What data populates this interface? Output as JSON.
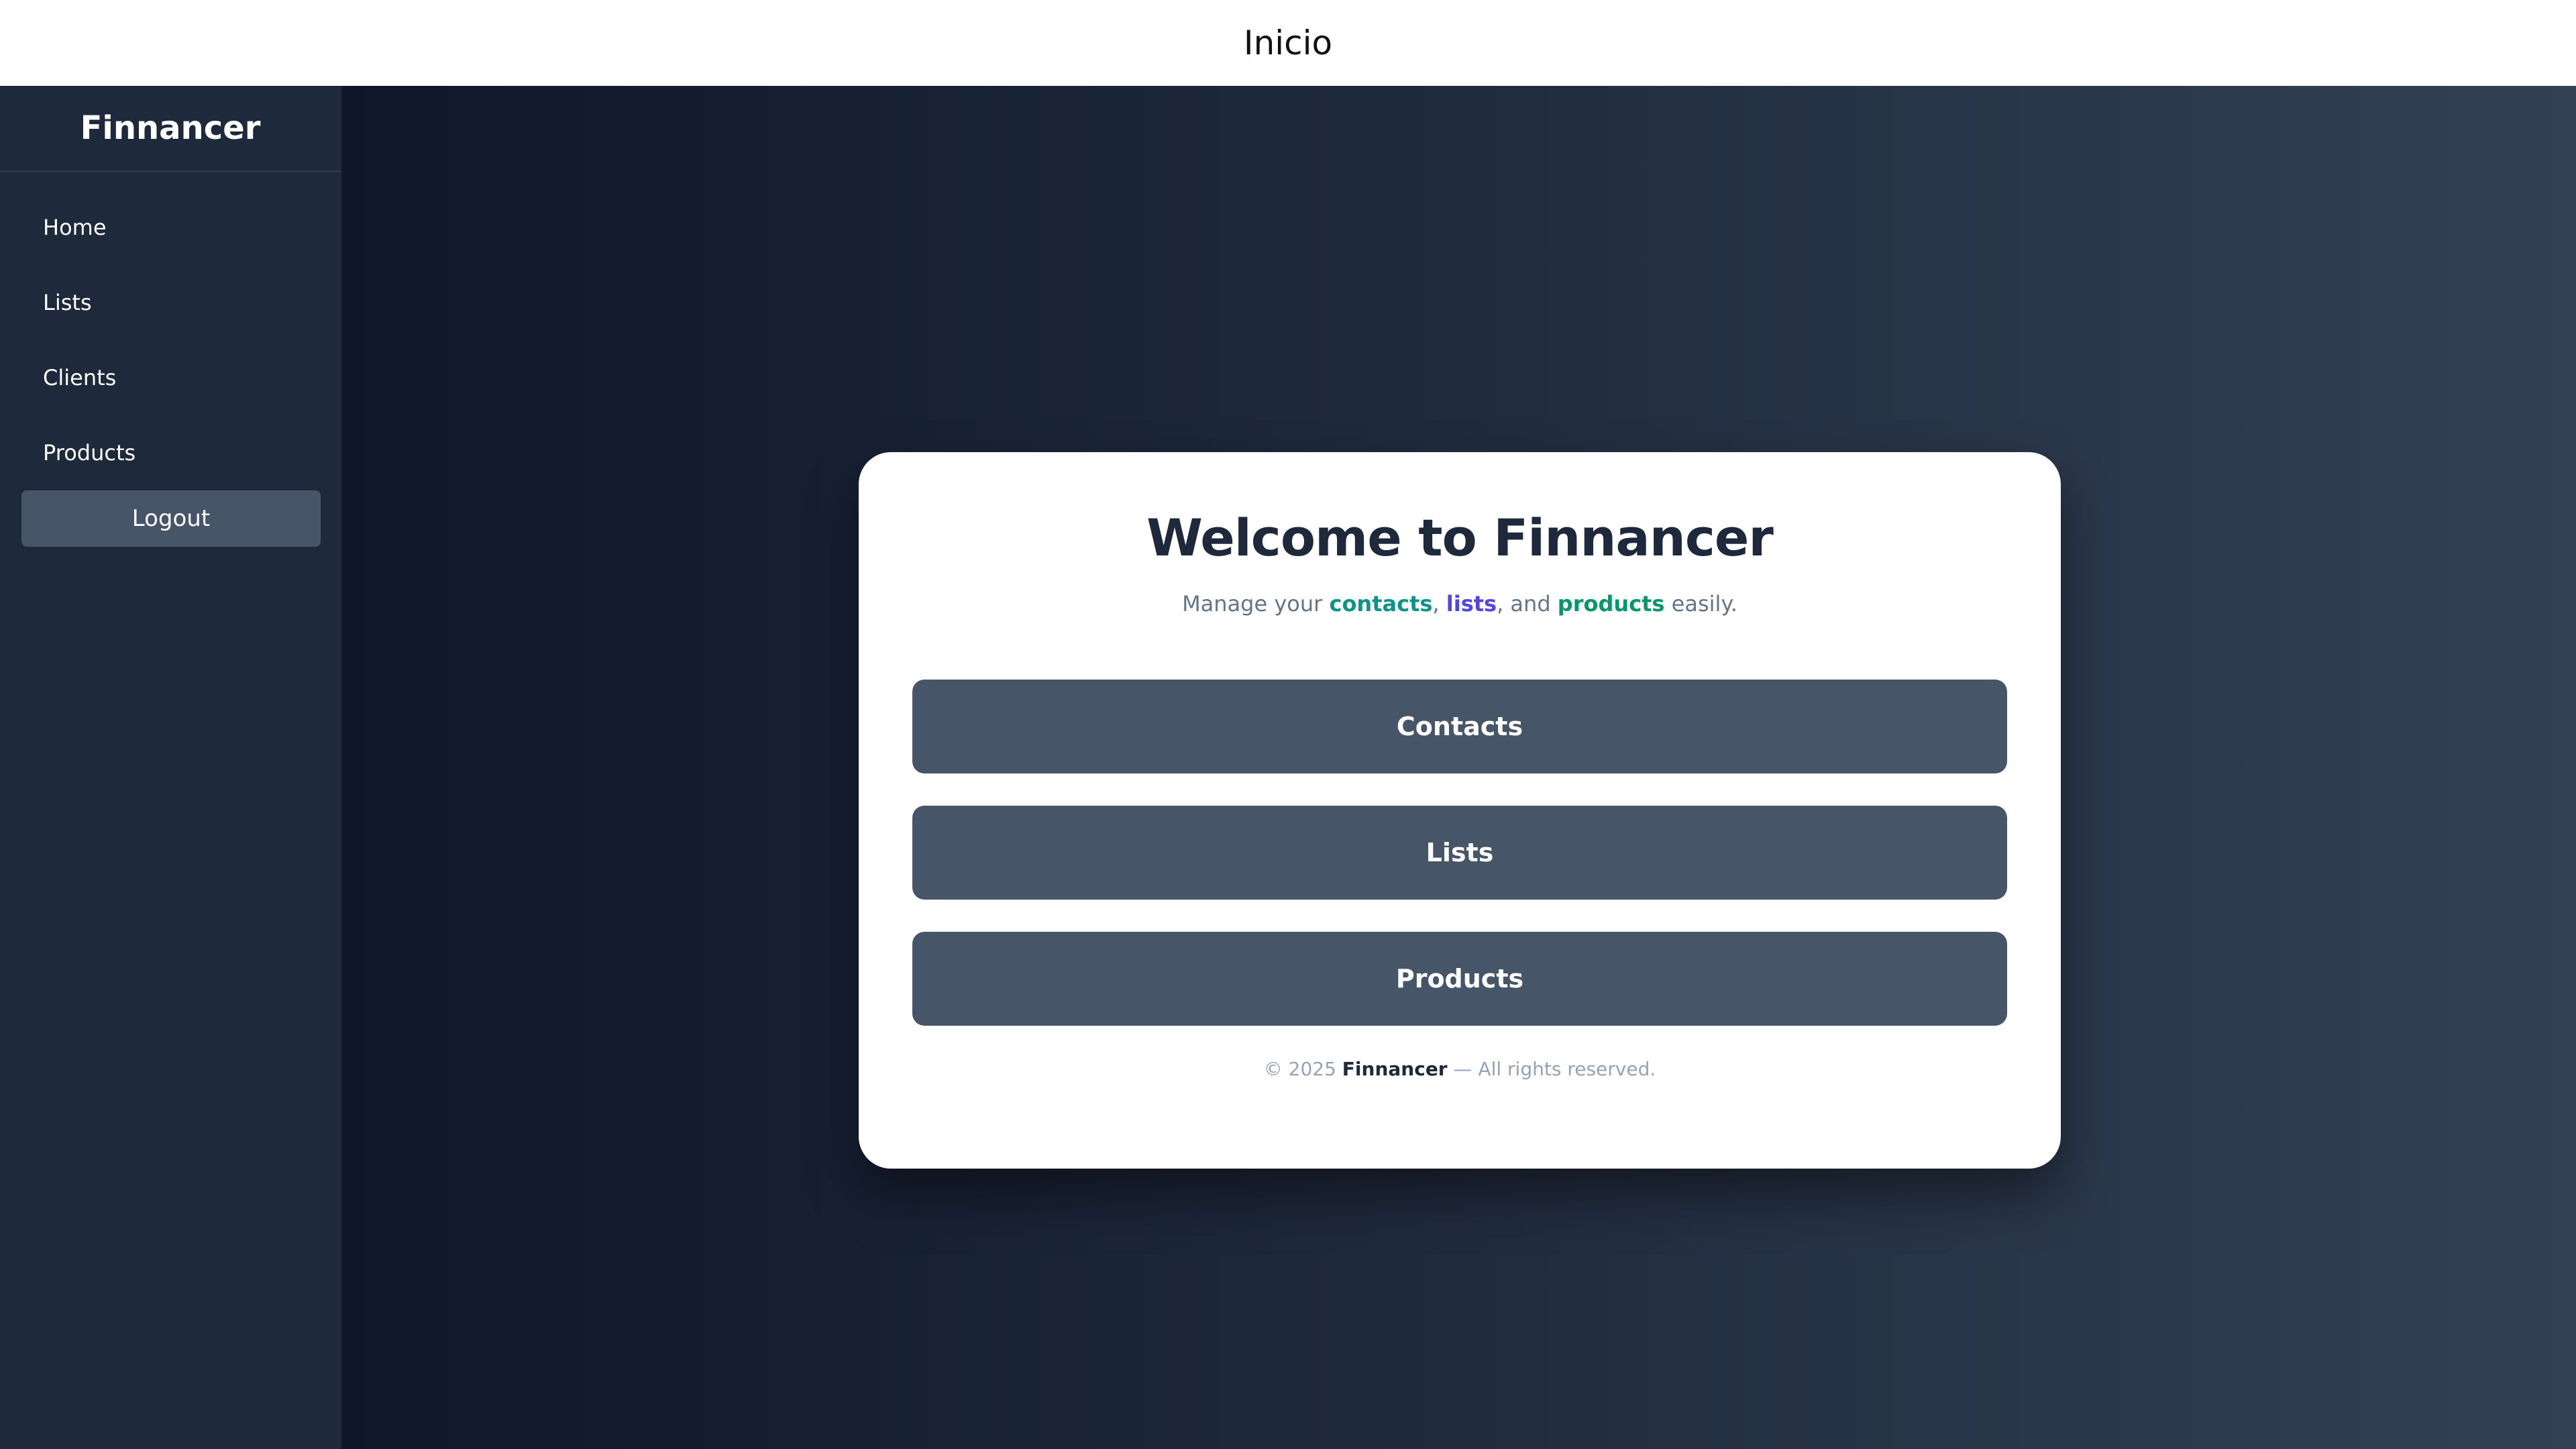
{
  "header": {
    "title": "Inicio"
  },
  "sidebar": {
    "brand": "Finnancer",
    "items": [
      {
        "label": "Home"
      },
      {
        "label": "Lists"
      },
      {
        "label": "Clients"
      },
      {
        "label": "Products"
      }
    ],
    "logout_label": "Logout"
  },
  "card": {
    "title": "Welcome to Finnancer",
    "subtitle": {
      "prefix": "Manage your ",
      "contacts": "contacts",
      "comma": ", ",
      "lists": "lists",
      "and": ", and ",
      "products": "products",
      "suffix": " easily."
    },
    "buttons": [
      {
        "label": "Contacts"
      },
      {
        "label": "Lists"
      },
      {
        "label": "Products"
      }
    ],
    "footer": {
      "prefix": "© 2025 ",
      "brand": "Finnancer",
      "suffix": " — All rights reserved."
    }
  },
  "colors": {
    "sidebar_bg": "#1e293b",
    "button_bg": "#475569",
    "contacts_accent": "#0d9488",
    "lists_accent": "#4f46e5",
    "products_accent": "#059669"
  }
}
